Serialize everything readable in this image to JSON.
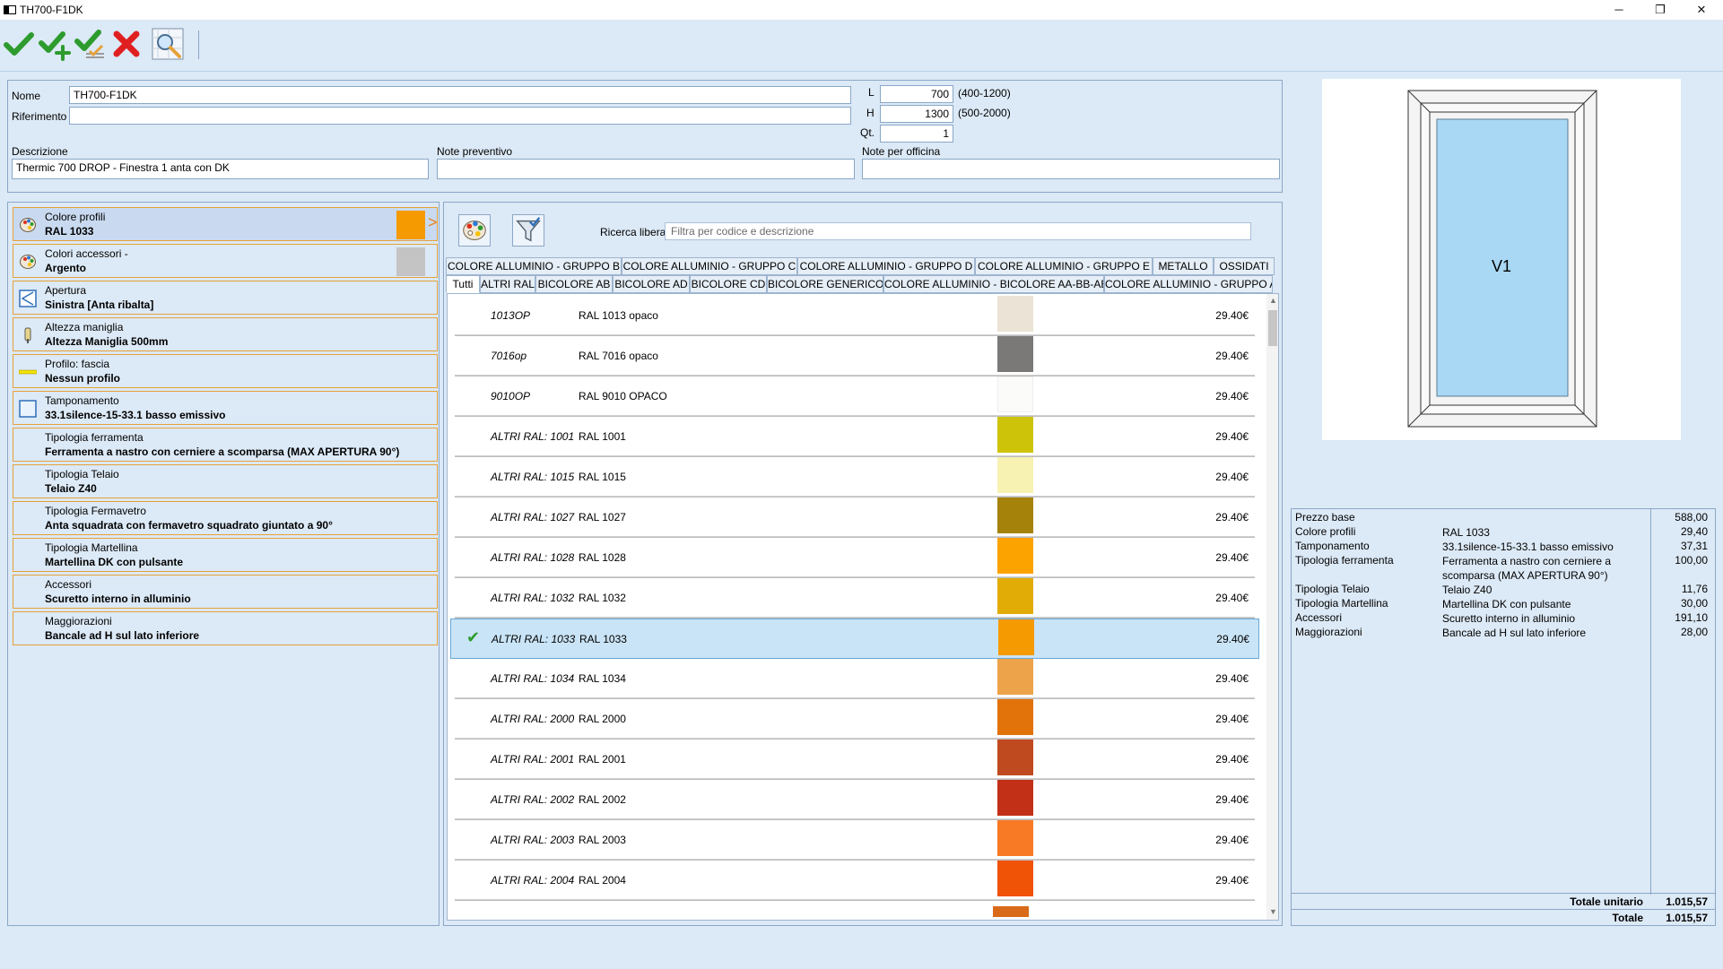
{
  "window": {
    "title": "TH700-F1DK",
    "minimize_glyph": "─",
    "maximize_glyph": "❐",
    "close_glyph": "✕"
  },
  "toolbar": {
    "buttons": [
      {
        "name": "confirm-icon"
      },
      {
        "name": "confirm-add-icon"
      },
      {
        "name": "confirm-multi-icon"
      },
      {
        "name": "cancel-icon"
      },
      {
        "name": "preview-zoom-icon"
      }
    ]
  },
  "header": {
    "nome_label": "Nome",
    "nome_value": "TH700-F1DK",
    "riferimento_label": "Riferimento",
    "riferimento_value": "",
    "descrizione_label": "Descrizione",
    "descrizione_value": "Thermic 700 DROP - Finestra 1 anta con DK",
    "note_preventivo_label": "Note preventivo",
    "note_preventivo_value": "",
    "note_officina_label": "Note per officina",
    "note_officina_value": "",
    "l_label": "L",
    "l_value": "700",
    "l_range": "(400-1200)",
    "h_label": "H",
    "h_value": "1300",
    "h_range": "(500-2000)",
    "qt_label": "Qt.",
    "qt_value": "1"
  },
  "options": [
    {
      "label": "Colore profili",
      "value": "RAL 1033",
      "icon": "palette-icon",
      "swatch": "#f59a00",
      "selected": true
    },
    {
      "label": "Colori accessori -",
      "value": "Argento",
      "icon": "palette-icon",
      "swatch": "#c4c4c4",
      "selected": false
    },
    {
      "label": "Apertura",
      "value": "Sinistra [Anta ribalta]",
      "icon": "opening-left-icon",
      "selected": false
    },
    {
      "label": "Altezza maniglia",
      "value": "Altezza Maniglia 500mm",
      "icon": "handle-icon",
      "selected": false
    },
    {
      "label": "Profilo: fascia",
      "value": "Nessun profilo",
      "icon": "profile-band-icon",
      "selected": false
    },
    {
      "label": "Tamponamento",
      "value": "33.1silence-15-33.1 basso emissivo",
      "icon": "glass-panel-icon",
      "selected": false
    },
    {
      "label": "Tipologia ferramenta",
      "value": "Ferramenta a nastro con cerniere a scomparsa (MAX APERTURA 90°)",
      "icon": "",
      "selected": false
    },
    {
      "label": "Tipologia Telaio",
      "value": "Telaio Z40",
      "icon": "",
      "selected": false
    },
    {
      "label": "Tipologia Fermavetro",
      "value": "Anta squadrata con fermavetro squadrato giuntato a 90°",
      "icon": "",
      "selected": false
    },
    {
      "label": "Tipologia Martellina",
      "value": "Martellina DK con pulsante",
      "icon": "",
      "selected": false
    },
    {
      "label": "Accessori",
      "value": "Scuretto interno in alluminio",
      "icon": "",
      "selected": false
    },
    {
      "label": "Maggiorazioni",
      "value": "Bancale ad H sul lato inferiore",
      "icon": "",
      "selected": false
    }
  ],
  "center": {
    "search_label": "Ricerca libera",
    "search_placeholder": "Filtra per codice e descrizione",
    "tabs_row1": [
      "COLORE ALLUMINIO - GRUPPO B",
      "COLORE ALLUMINIO - GRUPPO C",
      "COLORE ALLUMINIO - GRUPPO D",
      "COLORE ALLUMINIO - GRUPPO E",
      "METALLO",
      "OSSIDATI"
    ],
    "tabs_row2": [
      "Tutti",
      "ALTRI RAL",
      "BICOLORE AB",
      "BICOLORE AD",
      "BICOLORE CD",
      "BICOLORE GENERICO",
      "COLORE ALLUMINIO - BICOLORE AA-BB-AB",
      "COLORE ALLUMINIO - GRUPPO A"
    ],
    "active_tab": "Tutti",
    "rows": [
      {
        "code": "1013OP",
        "desc": "RAL 1013 opaco",
        "color": "#ebe3d5",
        "price": "29.40€",
        "selected": false
      },
      {
        "code": "7016op",
        "desc": "RAL 7016 opaco",
        "color": "#7b7978",
        "price": "29.40€",
        "selected": false
      },
      {
        "code": "9010OP",
        "desc": "RAL 9010 OPACO",
        "color": "#fbfbf9",
        "price": "29.40€",
        "selected": false
      },
      {
        "code": "ALTRI RAL: 1001",
        "desc": "RAL 1001",
        "color": "#cdc40a",
        "price": "29.40€",
        "selected": false
      },
      {
        "code": "ALTRI RAL: 1015",
        "desc": "RAL 1015",
        "color": "#f7f1b2",
        "price": "29.40€",
        "selected": false
      },
      {
        "code": "ALTRI RAL: 1027",
        "desc": "RAL 1027",
        "color": "#a5820a",
        "price": "29.40€",
        "selected": false
      },
      {
        "code": "ALTRI RAL: 1028",
        "desc": "RAL 1028",
        "color": "#fda300",
        "price": "29.40€",
        "selected": false
      },
      {
        "code": "ALTRI RAL: 1032",
        "desc": "RAL 1032",
        "color": "#e1ac06",
        "price": "29.40€",
        "selected": false
      },
      {
        "code": "ALTRI RAL: 1033",
        "desc": "RAL 1033",
        "color": "#f59a00",
        "price": "29.40€",
        "selected": true
      },
      {
        "code": "ALTRI RAL: 1034",
        "desc": "RAL 1034",
        "color": "#eda34a",
        "price": "29.40€",
        "selected": false
      },
      {
        "code": "ALTRI RAL: 2000",
        "desc": "RAL 2000",
        "color": "#e1730a",
        "price": "29.40€",
        "selected": false
      },
      {
        "code": "ALTRI RAL: 2001",
        "desc": "RAL 2001",
        "color": "#bf4a20",
        "price": "29.40€",
        "selected": false
      },
      {
        "code": "ALTRI RAL: 2002",
        "desc": "RAL 2002",
        "color": "#c33018",
        "price": "29.40€",
        "selected": false
      },
      {
        "code": "ALTRI RAL: 2003",
        "desc": "RAL 2003",
        "color": "#f87a25",
        "price": "29.40€",
        "selected": false
      },
      {
        "code": "ALTRI RAL: 2004",
        "desc": "RAL 2004",
        "color": "#f05206",
        "price": "29.40€",
        "selected": false
      }
    ]
  },
  "preview": {
    "label": "V1",
    "frame_color": "#f4f4f4",
    "glass_color": "#a9d8f5"
  },
  "summary": {
    "rows": [
      {
        "key": "Prezzo base",
        "value": "",
        "price": "588,00"
      },
      {
        "key": "Colore profili",
        "value": "RAL 1033",
        "price": "29,40"
      },
      {
        "key": "Tamponamento",
        "value": "33.1silence-15-33.1 basso emissivo",
        "price": "37,31"
      },
      {
        "key": "Tipologia ferramenta",
        "value": "Ferramenta a nastro con cerniere a scomparsa (MAX APERTURA 90°)",
        "price": "100,00"
      },
      {
        "key": "Tipologia Telaio",
        "value": "Telaio Z40",
        "price": "11,76"
      },
      {
        "key": "Tipologia Martellina",
        "value": "Martellina DK con pulsante",
        "price": "30,00"
      },
      {
        "key": "Accessori",
        "value": "Scuretto interno in alluminio",
        "price": "191,10"
      },
      {
        "key": "Maggiorazioni",
        "value": "Bancale ad H sul lato inferiore",
        "price": "28,00"
      }
    ],
    "totale_unitario_label": "Totale unitario",
    "totale_unitario_value": "1.015,57",
    "totale_label": "Totale",
    "totale_value": "1.015,57"
  },
  "colors": {
    "accent_orange": "#e6a13a",
    "panel_bg": "#dce9f6",
    "border": "#8aa7c7",
    "selection": "#c9e4f6"
  }
}
